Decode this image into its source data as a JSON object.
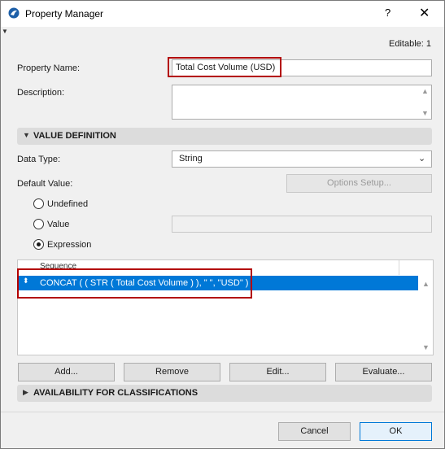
{
  "window": {
    "title": "Property Manager",
    "help_glyph": "?",
    "close_glyph": "✕"
  },
  "editable": "Editable: 1",
  "property_name": {
    "label": "Property Name:",
    "value": "Total Cost Volume (USD)"
  },
  "description": {
    "label": "Description:",
    "value": ""
  },
  "value_definition": {
    "header": "VALUE DEFINITION"
  },
  "data_type": {
    "label": "Data Type:",
    "selected": "String"
  },
  "default_value": {
    "label": "Default Value:",
    "options_button": "Options Setup..."
  },
  "radios": [
    {
      "label": "Undefined",
      "checked": false
    },
    {
      "label": "Value",
      "checked": false
    },
    {
      "label": "Expression",
      "checked": true
    }
  ],
  "expression_list": {
    "column_header": "Sequence",
    "rows": [
      {
        "text": "CONCAT ( ( STR ( Total Cost Volume ) ), \" \", \"USD\" )",
        "selected": true
      }
    ]
  },
  "buttons": {
    "add": "Add...",
    "remove": "Remove",
    "edit": "Edit...",
    "evaluate": "Evaluate..."
  },
  "availability": {
    "header": "AVAILABILITY FOR CLASSIFICATIONS"
  },
  "footer": {
    "cancel": "Cancel",
    "ok": "OK"
  },
  "colors": {
    "accent": "#0078d7",
    "highlight_box": "#b30000",
    "section_bar": "#dcdcdc"
  },
  "icons": [
    "app-logo-icon",
    "help-icon",
    "close-icon",
    "pin-icon",
    "chevron-down-icon",
    "collapse-triangle-icon",
    "expand-triangle-icon",
    "drag-handle-icon",
    "scroll-up-icon",
    "scroll-down-icon"
  ]
}
